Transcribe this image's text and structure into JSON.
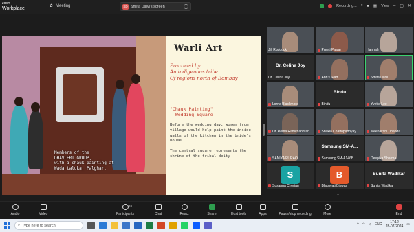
{
  "topbar": {
    "brand_top": "zoom",
    "brand": "Workplace",
    "meeting_label": "Meeting",
    "share_badge": "SD",
    "share_title": "Smita Dalvi's screen",
    "recording": "Recording...",
    "view": "View"
  },
  "slide": {
    "title": "Warli Art",
    "subtitle": "Practiced by\nAn indigenous tribe\nOf regions north of Bombay",
    "chauk": "\"Chauk Painting\"\n   - Wedding Square",
    "body1": "Before the wedding day, women from village would help paint the inside walls of the kitchen in the bride's house.",
    "body2": "The central square represents the shrine of the tribal deity",
    "caption": "Members of the\nDHAVLERI GROUP,\nwith a chauk painting at\nWada taluka, Palghar."
  },
  "participants": [
    {
      "name": "Jill Ruddock",
      "muted": false
    },
    {
      "name": "Preeti Pawar",
      "muted": true
    },
    {
      "name": "Hannah",
      "muted": false
    },
    {
      "name": "Dr. Celina Joy",
      "muted": false,
      "big": "Dr. Celina Joy"
    },
    {
      "name": "Ann's iPad",
      "muted": true
    },
    {
      "name": "Smita Dalvi",
      "muted": true
    },
    {
      "name": "Lorna Blackmore",
      "muted": true
    },
    {
      "name": "Bindu",
      "muted": true,
      "big": "Bindu"
    },
    {
      "name": "Yvette Lee",
      "muted": true
    },
    {
      "name": "Dr. Rema Ramchandran",
      "muted": true
    },
    {
      "name": "Shukla Chattopadhyay",
      "muted": true
    },
    {
      "name": "Meenakshi Dhanda",
      "muted": true
    },
    {
      "name": "SANIYA PURAO",
      "muted": true
    },
    {
      "name": "Samsung SM-A146B",
      "muted": true,
      "big": "Samsung SM-A..."
    },
    {
      "name": "Deepika Sharma",
      "muted": true
    },
    {
      "name": "Susanna Cherian",
      "muted": true,
      "avatar": "S"
    },
    {
      "name": "Bhaswati Biswas",
      "muted": true,
      "avatar": "B"
    },
    {
      "name": "Sunita Wadikar",
      "muted": true,
      "big": "Sunita Wadikar"
    }
  ],
  "toolbar": {
    "audio": "Audio",
    "video": "Video",
    "participants": "Participants",
    "participants_count": "25",
    "chat": "Chat",
    "react": "React",
    "share": "Share",
    "host_tools": "Host tools",
    "apps": "Apps",
    "pause_recording": "Pause/stop recording",
    "more": "More",
    "end": "End"
  },
  "taskbar": {
    "search_placeholder": "Type here to search",
    "lang": "ENG",
    "time": "17:12",
    "date": "28-07-2024"
  },
  "colors": {
    "accent_green": "#3bd16f",
    "end_red": "#e04343",
    "slide_bg": "#fbf6df",
    "slide_red": "#c0392b"
  }
}
